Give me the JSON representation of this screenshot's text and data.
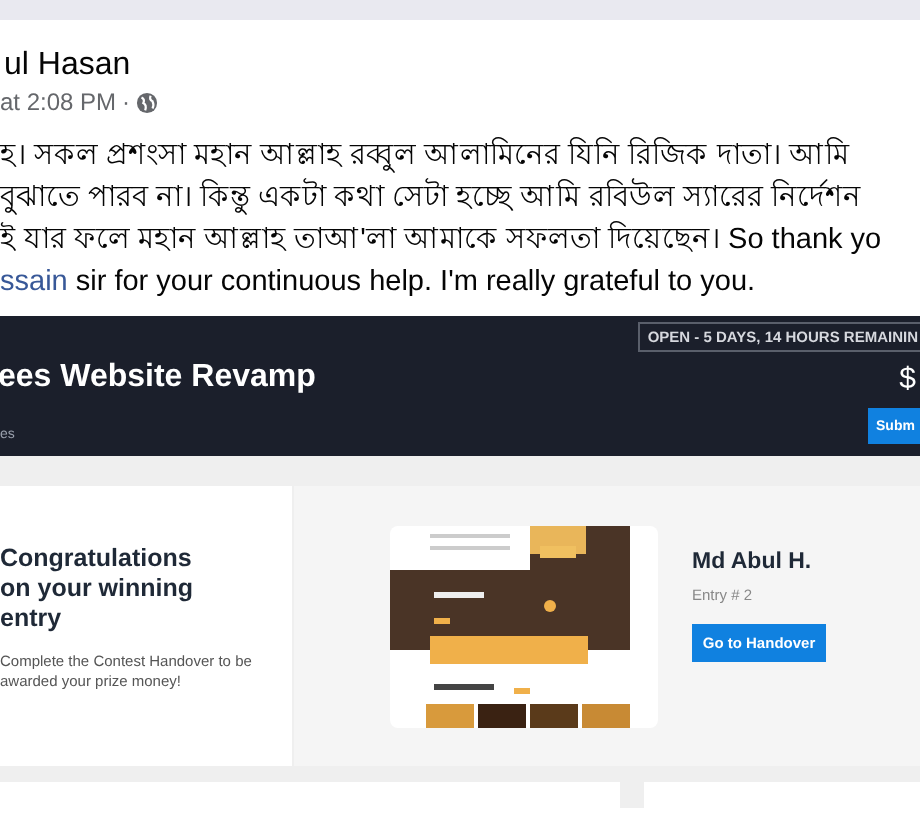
{
  "post": {
    "author": "ul Hasan",
    "time": "at 2:08 PM",
    "separator": "·",
    "lines": [
      {
        "text": "হ। সকল প্রশংসা মহান আল্লাহ রব্বুল আলামিনের যিনি রিজিক দাতা। আমি"
      },
      {
        "text": "বুঝাতে পারব না। কিন্তু একটা কথা সেটা হচ্ছে আমি রবিউল স্যারের নির্দেশন"
      },
      {
        "text": "ই যার ফলে মহান আল্লাহ তাআ'লা আমাকে সফলতা দিয়েছেন। So thank yo"
      }
    ],
    "link": "ssain",
    "last_line": " sir for your continuous help. I'm really grateful to you."
  },
  "contest": {
    "status": "OPEN - 5 DAYS, 14 HOURS REMAININ",
    "title": "ees Website Revamp",
    "prize": "$",
    "subtitle": "es",
    "submit": "Subm",
    "congrats_title": "Congratulations on your winning entry",
    "congrats_text": "Complete the Contest Handover to be awarded your prize money!",
    "winner": "Md Abul H.",
    "entry": "Entry # 2",
    "handover": "Go to Handover"
  }
}
